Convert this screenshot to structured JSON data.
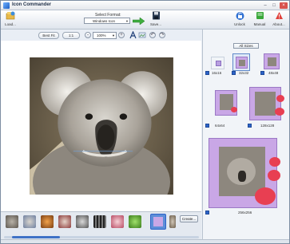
{
  "window": {
    "title": "Icon Commander"
  },
  "toolbar": {
    "load_label": "Load...",
    "format_label": "Select Format:",
    "format_value": "Windows Icon",
    "save_label": "Save...",
    "unlock_label": "Unlock",
    "manual_label": "Manual",
    "about_label": "About..."
  },
  "zoombar": {
    "best_fit_label": "Best Fit",
    "one_to_one_label": "1:1",
    "zoom_value": "100%",
    "zoom_out_label": "-",
    "zoom_in_label": "+"
  },
  "sizes_panel": {
    "all_sizes_label": "All Sizes",
    "sizes": [
      "16x16",
      "32x32",
      "48x48",
      "64x64",
      "128x128",
      "256x256"
    ],
    "selected_size": "32x32"
  },
  "filmstrip": {
    "create_label": "Create...",
    "items": [
      "koala",
      "macaw",
      "bird",
      "dog",
      "film",
      "gift",
      "frog",
      "frame",
      "dog2"
    ]
  },
  "colors": {
    "accent": "#2d63c8",
    "frame_lilac": "#c9a7e6",
    "heart_red": "#e83f52"
  }
}
